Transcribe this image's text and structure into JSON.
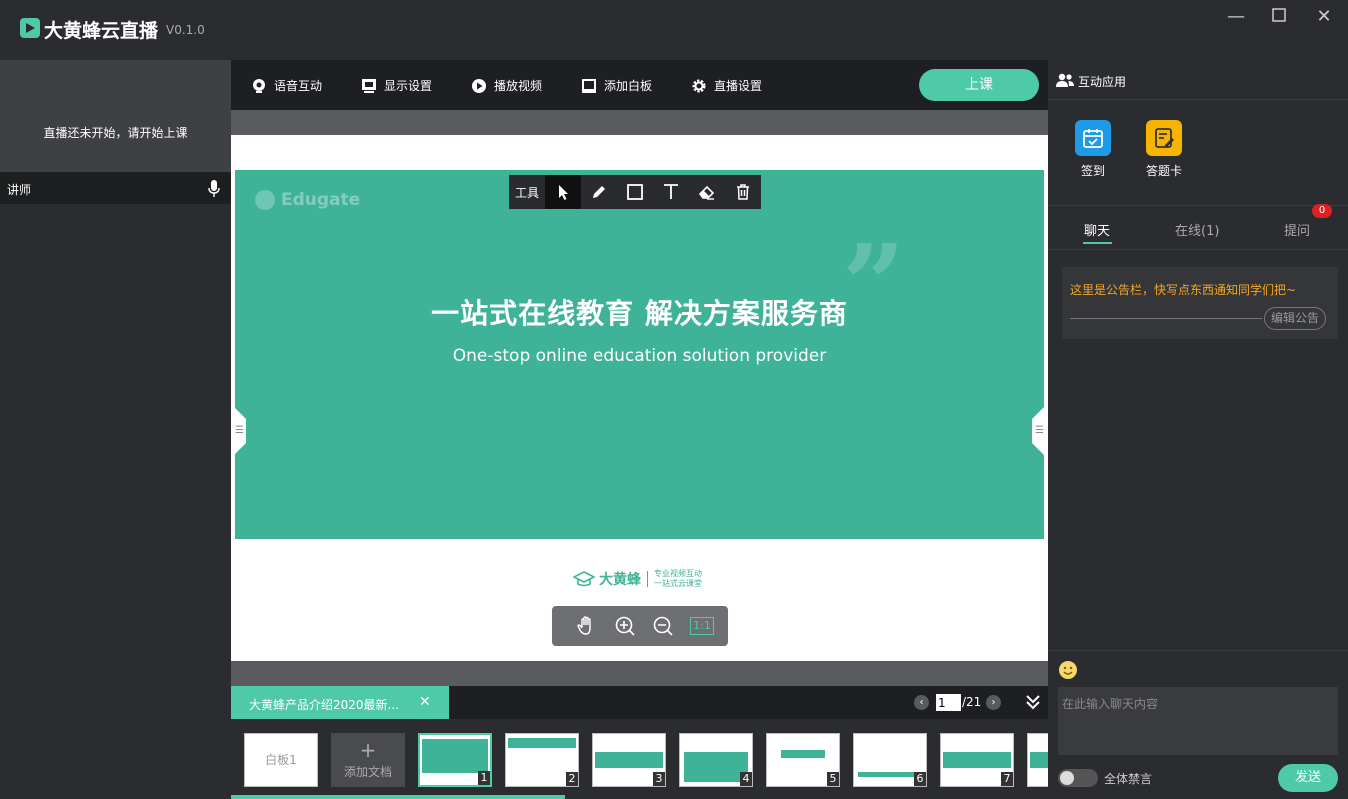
{
  "app": {
    "title": "大黄蜂云直播",
    "version": "V0.1.0",
    "accent_color": "#4ecaa9",
    "slide_color": "#3fb398"
  },
  "window_controls": {
    "minimize": "—",
    "maximize": "☐",
    "close": "✕"
  },
  "left_panel": {
    "video_message": "直播还未开始，请开始上课",
    "lecturer_label": "讲师",
    "mic_icon": "microphone-icon"
  },
  "toolbar": {
    "items": [
      {
        "label": "语音互动",
        "icon": "voice-icon"
      },
      {
        "label": "显示设置",
        "icon": "display-icon"
      },
      {
        "label": "播放视频",
        "icon": "play-icon"
      },
      {
        "label": "添加白板",
        "icon": "whiteboard-icon"
      },
      {
        "label": "直播设置",
        "icon": "gear-icon"
      }
    ],
    "start_class_label": "上课"
  },
  "draw_tools": {
    "label": "工具",
    "tools": [
      "cursor-icon",
      "pen-icon",
      "rectangle-icon",
      "text-icon",
      "eraser-icon",
      "trash-icon"
    ]
  },
  "slide": {
    "watermark": "Edugate",
    "quote_mark": "”",
    "title": "一站式在线教育 解决方案服务商",
    "subtitle": "One-stop online education solution provider",
    "brand_name": "大黄蜂",
    "brand_slogan_1": "专业视频互动",
    "brand_slogan_2": "一站式云课堂"
  },
  "zoom_tools": {
    "ratio_label": "1:1",
    "icons": [
      "hand-icon",
      "zoom-in-icon",
      "zoom-out-icon"
    ]
  },
  "doc_bar": {
    "doc_name": "大黄蜂产品介绍2020最新...",
    "close": "✕",
    "prev": "‹",
    "next": "›",
    "current_page": "1",
    "total_pages": "/21"
  },
  "thumbnails": {
    "whiteboard_label": "白板1",
    "add_doc_plus": "+",
    "add_doc_label": "添加文档",
    "pages": [
      "1",
      "2",
      "3",
      "4",
      "5",
      "6",
      "7"
    ]
  },
  "right_panel": {
    "header_label": "互动应用",
    "apps": [
      {
        "label": "签到",
        "icon": "calendar-check-icon",
        "color": "#1e9be8"
      },
      {
        "label": "答题卡",
        "icon": "edit-card-icon",
        "color": "#f5b400"
      }
    ],
    "tabs": [
      {
        "label": "聊天"
      },
      {
        "label": "在线(1)"
      },
      {
        "label": "提问"
      }
    ],
    "question_badge": "0",
    "notice_text": "这里是公告栏，快写点东西通知同学们把~",
    "notice_edit_label": "编辑公告",
    "chat_placeholder": "在此输入聊天内容",
    "mute_all_label": "全体禁言",
    "send_label": "发送"
  }
}
